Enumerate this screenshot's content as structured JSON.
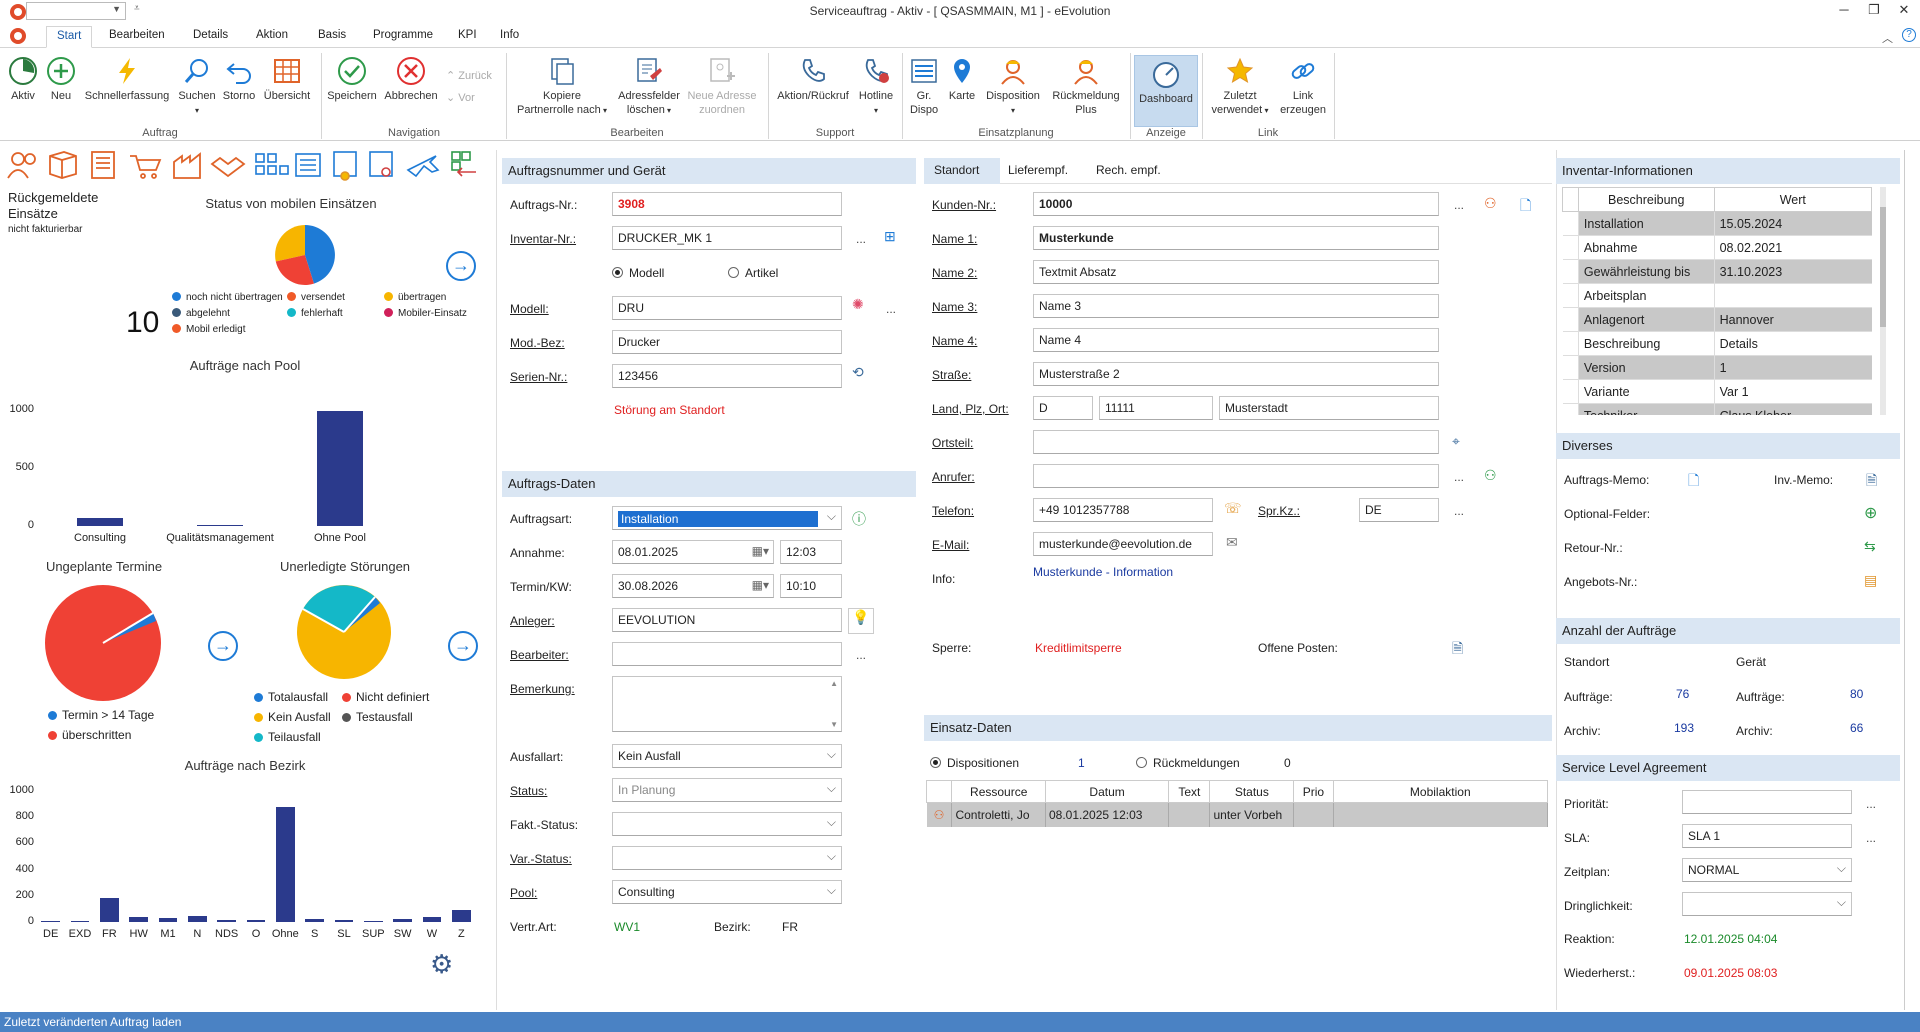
{
  "window": {
    "title": "Serviceauftrag - Aktiv - [ QSASMMAIN, M1 ]  -  eEvolution"
  },
  "tabs": [
    "Start",
    "Bearbeiten",
    "Details",
    "Aktion",
    "Basis",
    "Programme",
    "KPI",
    "Info"
  ],
  "ribbon": {
    "auftrag": {
      "aktiv": "Aktiv",
      "neu": "Neu",
      "schnellerfassung": "Schnellerfassung",
      "suchen": "Suchen",
      "storno": "Storno",
      "uebersicht": "Übersicht",
      "label": "Auftrag"
    },
    "navigation": {
      "speichern": "Speichern",
      "abbrechen": "Abbrechen",
      "zurueck": "Zurück",
      "vor": "Vor",
      "label": "Navigation"
    },
    "bearbeiten": {
      "kopiere": "Kopiere",
      "kopiere2": "Partnerrolle nach",
      "adressfelder": "Adressfelder",
      "adressfelder2": "löschen",
      "neue_adresse": "Neue Adresse",
      "neue_adresse2": "zuordnen",
      "label": "Bearbeiten"
    },
    "support": {
      "aktion": "Aktion/Rückruf",
      "hotline": "Hotline",
      "label": "Support"
    },
    "einsatzplanung": {
      "gr_dispo": "Gr.",
      "gr_dispo2": "Dispo",
      "karte": "Karte",
      "disposition": "Disposition",
      "rueckmeldung": "Rückmeldung",
      "rueckmeldung2": "Plus",
      "label": "Einsatzplanung"
    },
    "anzeige": {
      "dashboard": "Dashboard",
      "label": "Anzeige"
    },
    "link": {
      "zuletzt": "Zuletzt",
      "zuletzt2": "verwendet",
      "link_erzeugen": "Link",
      "link_erzeugen2": "erzeugen",
      "label": "Link"
    }
  },
  "dashboard": {
    "rueckgemeldet": "Rückgemeldete",
    "einsaetze": "Einsätze",
    "nicht_fakturierbar": "nicht fakturierbar",
    "count": "10",
    "status_title": "Status von mobilen Einsätzen",
    "status_legend": [
      {
        "label": "noch nicht übertragen",
        "color": "#1e7bd6"
      },
      {
        "label": "versendet",
        "color": "#f05a28"
      },
      {
        "label": "übertragen",
        "color": "#f7b500"
      },
      {
        "label": "abgelehnt",
        "color": "#3a5a7a"
      },
      {
        "label": "fehlerhaft",
        "color": "#14b8c8"
      },
      {
        "label": "Mobiler-Einsatz",
        "color": "#d0205a"
      },
      {
        "label": "Mobil erledigt",
        "color": "#f05a28"
      }
    ],
    "pool_chart": {
      "type": "bar",
      "title": "Aufträge nach Pool",
      "categories": [
        "Consulting",
        "Qualitätsmanagement",
        "Ohne Pool"
      ],
      "values": [
        70,
        5,
        990
      ],
      "yticks": [
        "1000",
        "500",
        "0"
      ],
      "ylim": [
        0,
        1000
      ]
    },
    "ungeplant": {
      "title": "Ungeplante Termine",
      "legend": [
        {
          "label": "Termin > 14 Tage",
          "color": "#1e7bd6"
        },
        {
          "label": "überschritten",
          "color": "#ef4135"
        }
      ]
    },
    "stoerungen": {
      "title": "Unerledigte Störungen",
      "legend": [
        {
          "label": "Totalausfall",
          "color": "#1e7bd6"
        },
        {
          "label": "Nicht definiert",
          "color": "#ef4135"
        },
        {
          "label": "Kein Ausfall",
          "color": "#f7b500"
        },
        {
          "label": "Testausfall",
          "color": "#555555"
        },
        {
          "label": "Teilausfall",
          "color": "#14b8c8"
        }
      ]
    },
    "bezirk_chart": {
      "type": "bar",
      "title": "Aufträge nach Bezirk",
      "categories": [
        "DE",
        "EXD",
        "FR",
        "HW",
        "M1",
        "N",
        "NDS",
        "O",
        "Ohne",
        "S",
        "SL",
        "SUP",
        "SW",
        "W",
        "Z"
      ],
      "values": [
        10,
        5,
        180,
        35,
        30,
        45,
        15,
        15,
        880,
        20,
        15,
        10,
        25,
        40,
        90
      ],
      "yticks": [
        "1000",
        "800",
        "600",
        "400",
        "200",
        "0"
      ],
      "ylim": [
        0,
        1000
      ]
    }
  },
  "chart_data": [
    {
      "type": "pie",
      "title": "Status von mobilen Einsätzen",
      "categories": [
        "noch nicht übertragen",
        "versendet",
        "übertragen"
      ],
      "values": [
        35,
        30,
        35
      ]
    },
    {
      "type": "bar",
      "title": "Aufträge nach Pool",
      "categories": [
        "Consulting",
        "Qualitätsmanagement",
        "Ohne Pool"
      ],
      "values": [
        70,
        5,
        990
      ],
      "ylim": [
        0,
        1000
      ]
    },
    {
      "type": "pie",
      "title": "Ungeplante Termine",
      "categories": [
        "Termin > 14 Tage",
        "überschritten"
      ],
      "values": [
        3,
        97
      ]
    },
    {
      "type": "pie",
      "title": "Unerledigte Störungen",
      "categories": [
        "Kein Ausfall",
        "Teilausfall",
        "Totalausfall"
      ],
      "values": [
        72,
        26,
        2
      ]
    },
    {
      "type": "bar",
      "title": "Aufträge nach Bezirk",
      "categories": [
        "DE",
        "EXD",
        "FR",
        "HW",
        "M1",
        "N",
        "NDS",
        "O",
        "Ohne",
        "S",
        "SL",
        "SUP",
        "SW",
        "W",
        "Z"
      ],
      "values": [
        10,
        5,
        180,
        35,
        30,
        45,
        15,
        15,
        880,
        20,
        15,
        10,
        25,
        40,
        90
      ],
      "ylim": [
        0,
        1000
      ]
    }
  ],
  "auftrag": {
    "header": "Auftragsnummer und Gerät",
    "auftragsnr_label": "Auftrags-Nr.:",
    "auftragsnr": "3908",
    "inventar_label": "Inventar-Nr.:",
    "inventar": "DRUCKER_MK 1",
    "modell_radio": "Modell",
    "artikel_radio": "Artikel",
    "modell_label": "Modell:",
    "modell": "DRU",
    "modbez_label": "Mod.-Bez:",
    "modbez": "Drucker",
    "serien_label": "Serien-Nr.:",
    "serien": "123456",
    "stoerung": "Störung am Standort"
  },
  "auftragsdaten": {
    "header": "Auftrags-Daten",
    "auftragsart_label": "Auftragsart:",
    "auftragsart": "Installation",
    "annahme_label": "Annahme:",
    "annahme_date": "08.01.2025",
    "annahme_time": "12:03",
    "termin_label": "Termin/KW:",
    "termin_date": "30.08.2026",
    "termin_time": "10:10",
    "anleger_label": "Anleger:",
    "anleger": "EEVOLUTION",
    "bearbeiter_label": "Bearbeiter:",
    "bearbeiter": "",
    "bemerkung_label": "Bemerkung:",
    "bemerkung": "",
    "ausfallart_label": "Ausfallart:",
    "ausfallart": "Kein Ausfall",
    "status_label": "Status:",
    "status": "In Planung",
    "fakt_label": "Fakt.-Status:",
    "fakt": "",
    "var_label": "Var.-Status:",
    "var": "",
    "pool_label": "Pool:",
    "pool": "Consulting",
    "vertr_label": "Vertr.Art:",
    "vertr": "WV1",
    "bezirk_label": "Bezirk:",
    "bezirk": "FR"
  },
  "standort": {
    "tabs": [
      "Standort",
      "Lieferempf.",
      "Rech. empf."
    ],
    "kunden_label": "Kunden-Nr.:",
    "kunden": "10000",
    "name1_label": "Name 1:",
    "name1": "Musterkunde",
    "name2_label": "Name 2:",
    "name2": "Textmit Absatz",
    "name3_label": "Name 3:",
    "name3": "Name 3",
    "name4_label": "Name 4:",
    "name4": "Name 4",
    "strasse_label": "Straße:",
    "strasse": "Musterstraße 2",
    "land_label": "Land, Plz, Ort:",
    "land": "D",
    "plz": "11111",
    "ort": "Musterstadt",
    "ortsteil_label": "Ortsteil:",
    "ortsteil": "",
    "anrufer_label": "Anrufer:",
    "anrufer": "",
    "telefon_label": "Telefon:",
    "telefon": "+49 1012357788",
    "sprkz_label": "Spr.Kz.:",
    "sprkz": "DE",
    "email_label": "E-Mail:",
    "email": "musterkunde@eevolution.de",
    "info_label": "Info:",
    "info": "Musterkunde - Information",
    "sperre_label": "Sperre:",
    "sperre": "Kreditlimitsperre",
    "offene_label": "Offene Posten:"
  },
  "einsatz": {
    "header": "Einsatz-Daten",
    "dispositionen_label": "Dispositionen",
    "dispositionen": "1",
    "rueckmeldungen_label": "Rückmeldungen",
    "rueckmeldungen": "0",
    "columns": [
      "Ressource",
      "Datum",
      "Text",
      "Status",
      "Prio",
      "Mobilaktion"
    ],
    "rows": [
      [
        "Controletti, Jo",
        "08.01.2025 12:03",
        "",
        "unter Vorbeh",
        "",
        ""
      ]
    ]
  },
  "inventar": {
    "header": "Inventar-Informationen",
    "columns": [
      "Beschreibung",
      "Wert"
    ],
    "rows": [
      [
        "Installation",
        "15.05.2024"
      ],
      [
        "Abnahme",
        "08.02.2021"
      ],
      [
        "Gewährleistung bis",
        "31.10.2023"
      ],
      [
        "Arbeitsplan",
        ""
      ],
      [
        "Anlagenort",
        "Hannover"
      ],
      [
        "Beschreibung",
        "Details"
      ],
      [
        "Version",
        "1"
      ],
      [
        "Variante",
        "Var 1"
      ],
      [
        "Techniker",
        "Claus Kleber"
      ]
    ]
  },
  "diverses": {
    "header": "Diverses",
    "auftrags_memo": "Auftrags-Memo:",
    "inv_memo": "Inv.-Memo:",
    "optional": "Optional-Felder:",
    "retour": "Retour-Nr.:",
    "angebots": "Angebots-Nr.:"
  },
  "anzahl": {
    "header": "Anzahl der Aufträge",
    "standort": "Standort",
    "geraet": "Gerät",
    "auftraege_label": "Aufträge:",
    "archiv_label": "Archiv:",
    "standort_auftraege": "76",
    "standort_archiv": "193",
    "geraet_auftraege": "80",
    "geraet_archiv": "66"
  },
  "sla": {
    "header": "Service Level Agreement",
    "prioritaet_label": "Priorität:",
    "prioritaet": "",
    "sla_label": "SLA:",
    "sla": "SLA 1",
    "zeitplan_label": "Zeitplan:",
    "zeitplan": "NORMAL",
    "dringlichkeit_label": "Dringlichkeit:",
    "dringlichkeit": "",
    "reaktion_label": "Reaktion:",
    "reaktion": "12.01.2025 04:04",
    "wiederherst_label": "Wiederherst.:",
    "wiederherst": "09.01.2025 08:03"
  },
  "statusbar": {
    "text": "Zuletzt veränderten Auftrag laden"
  }
}
